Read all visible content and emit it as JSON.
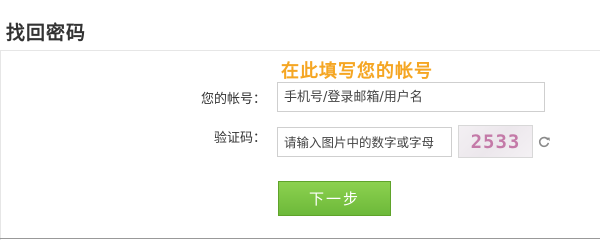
{
  "page": {
    "title": "找回密码",
    "hint": "在此填写您的帐号"
  },
  "form": {
    "account_label": "您的帐号：",
    "account_placeholder": "手机号/登录邮箱/用户名",
    "captcha_label": "验证码：",
    "captcha_placeholder": "请输入图片中的数字或字母",
    "captcha_code": "2533",
    "next_label": "下一步"
  },
  "colors": {
    "hint": "#f5a623",
    "button": "#7cc444",
    "captcha_text": "#c47aa8"
  },
  "icons": {
    "refresh": "refresh-icon"
  }
}
